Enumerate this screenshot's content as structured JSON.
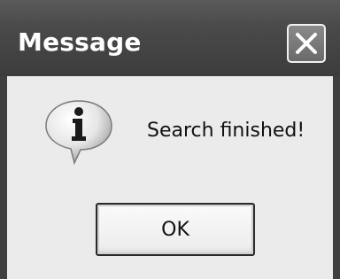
{
  "dialog": {
    "title": "Message",
    "message": "Search finished!",
    "ok_label": "OK",
    "icon": "info-icon",
    "close_icon": "close-icon"
  }
}
